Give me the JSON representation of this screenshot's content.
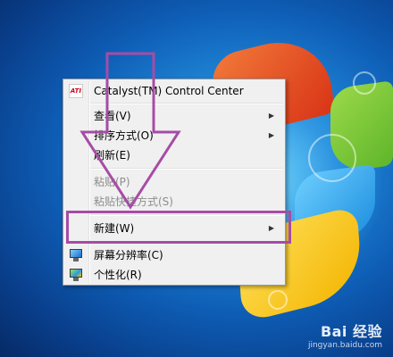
{
  "menu": {
    "items": [
      {
        "label": "Catalyst(TM) Control Center",
        "icon": "ati-icon",
        "disabled": false,
        "submenu": false
      },
      {
        "label": "查看(V)",
        "disabled": false,
        "submenu": true
      },
      {
        "label": "排序方式(O)",
        "disabled": false,
        "submenu": true
      },
      {
        "label": "刷新(E)",
        "disabled": false,
        "submenu": false
      },
      {
        "label": "粘贴(P)",
        "disabled": true,
        "submenu": false
      },
      {
        "label": "粘贴快捷方式(S)",
        "disabled": true,
        "submenu": false
      },
      {
        "label": "新建(W)",
        "disabled": false,
        "submenu": true
      },
      {
        "label": "屏幕分辨率(C)",
        "icon": "screen-resolution-icon",
        "disabled": false,
        "submenu": false
      },
      {
        "label": "个性化(R)",
        "icon": "personalize-icon",
        "disabled": false,
        "submenu": false
      }
    ],
    "submenu_arrow": "▶"
  },
  "watermark": {
    "logo": "Bai 经验",
    "url": "jingyan.baidu.com"
  },
  "colors": {
    "annotation": "#a64ca6",
    "menu_bg": "#f0f0f0"
  }
}
